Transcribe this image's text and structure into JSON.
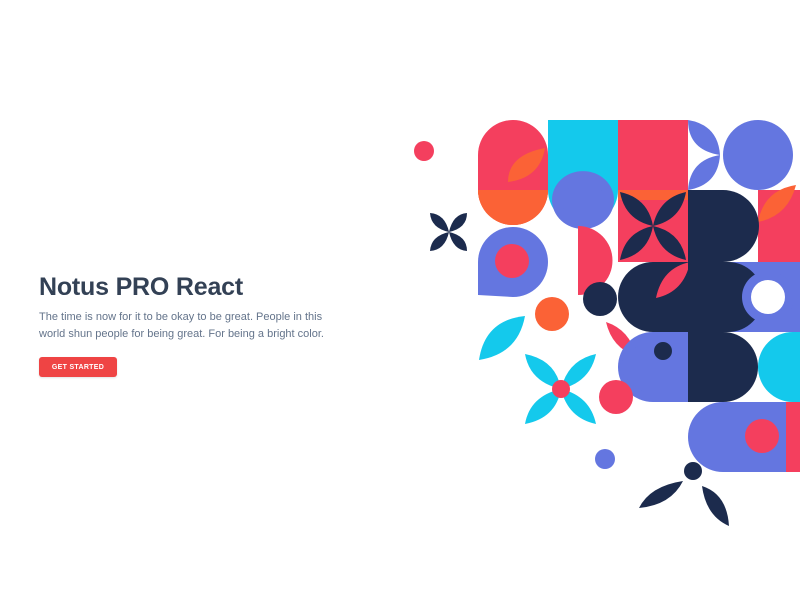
{
  "hero": {
    "title": "Notus PRO React",
    "description": "The time is now for it to be okay to be great. People in this world shun people for being great. For being a bright color.",
    "cta_label": "GET STARTED"
  },
  "illustration": {
    "icon": "geometric-pattern-illustration",
    "colors": {
      "pink": "#f43f5e",
      "cyan": "#14c9ec",
      "indigo": "#6476e0",
      "navy": "#1c2b4d",
      "orange": "#fb6236",
      "red_accent": "#ef4444"
    }
  }
}
